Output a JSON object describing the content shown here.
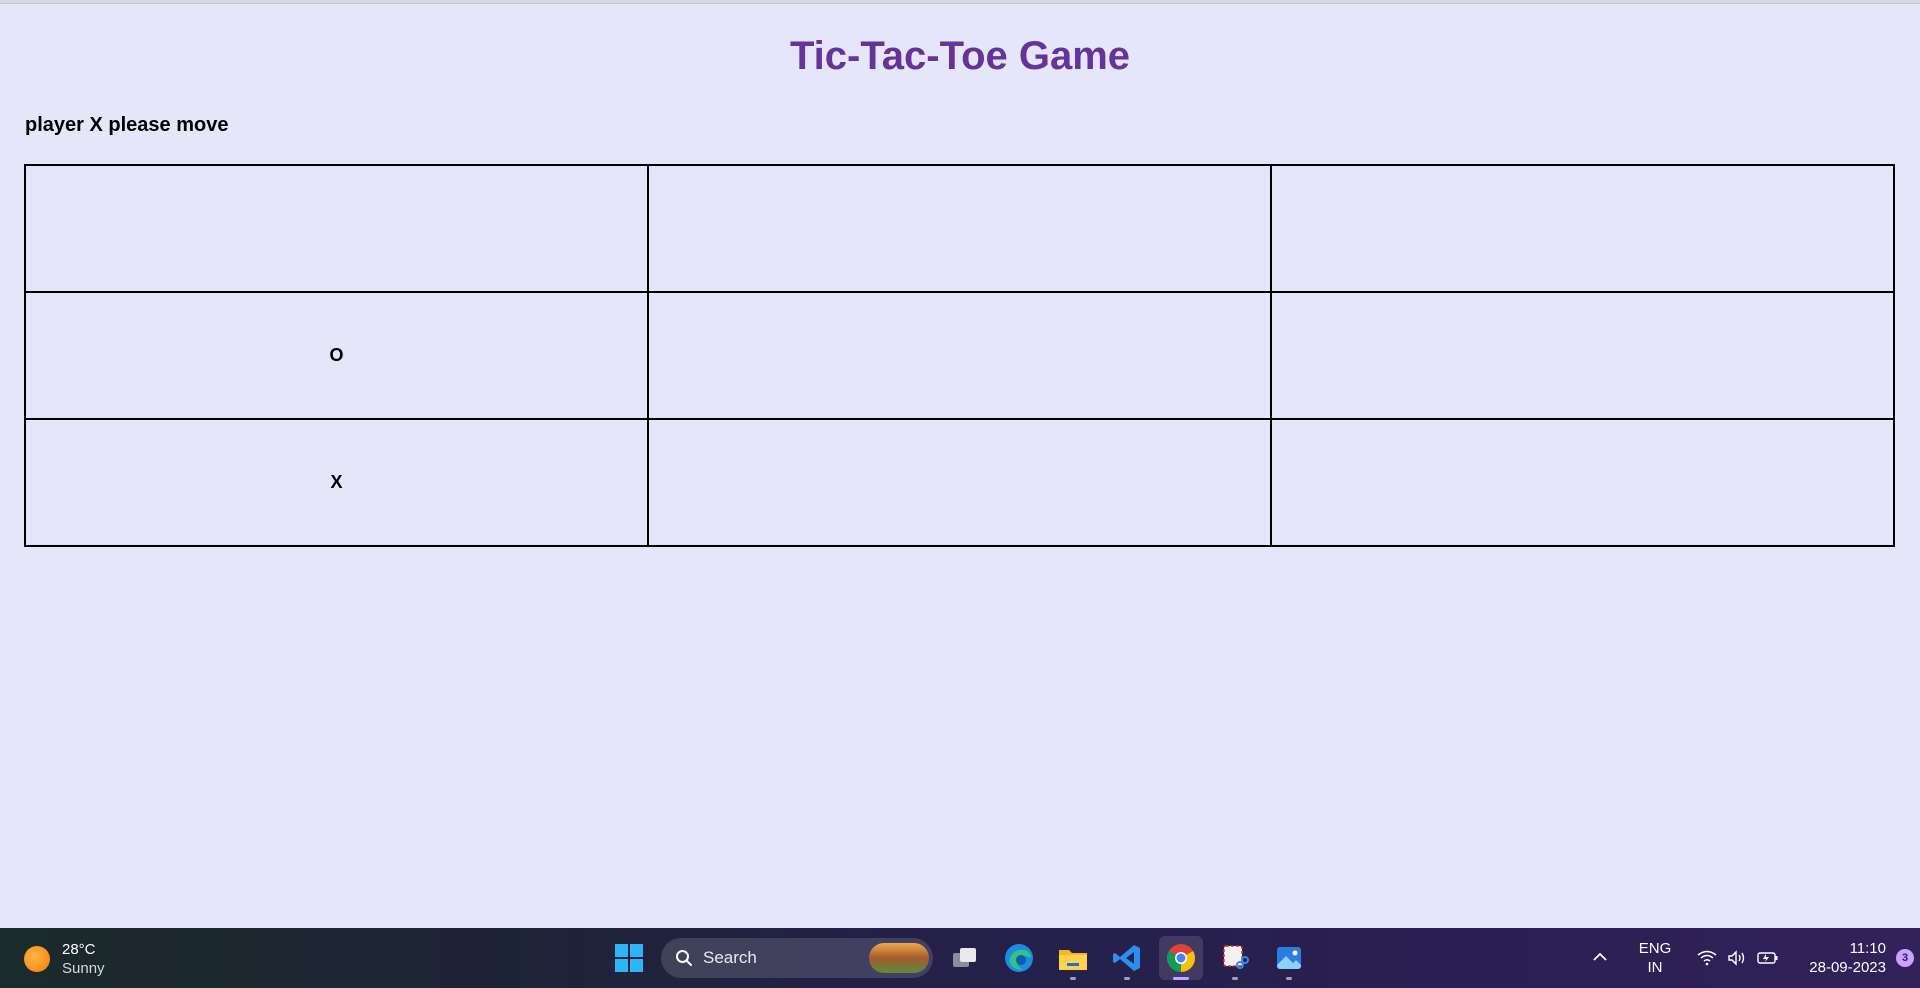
{
  "page": {
    "title": "Tic-Tac-Toe Game",
    "status": "player X please move"
  },
  "board": {
    "cells": [
      [
        "",
        "",
        ""
      ],
      [
        "O",
        "",
        ""
      ],
      [
        "X",
        "",
        ""
      ]
    ]
  },
  "taskbar": {
    "weather": {
      "temperature": "28°C",
      "condition": "Sunny",
      "icon": "sun-icon"
    },
    "search_label": "Search",
    "apps": [
      {
        "name": "start",
        "icon": "windows-start-icon"
      },
      {
        "name": "task-view",
        "icon": "task-view-icon"
      },
      {
        "name": "edge",
        "icon": "edge-browser-icon"
      },
      {
        "name": "file-explorer",
        "icon": "folder-icon"
      },
      {
        "name": "vscode",
        "icon": "vscode-icon"
      },
      {
        "name": "chrome",
        "icon": "chrome-icon",
        "active": true
      },
      {
        "name": "snipping-tool",
        "icon": "snipping-tool-icon"
      },
      {
        "name": "photos",
        "icon": "photos-icon"
      }
    ],
    "language": {
      "line1": "ENG",
      "line2": "IN"
    },
    "clock": {
      "time": "11:10",
      "date": "28-09-2023"
    },
    "notifications": "3"
  },
  "colors": {
    "background": "#e6e6fa",
    "title": "#663399",
    "grid": "#000000"
  }
}
